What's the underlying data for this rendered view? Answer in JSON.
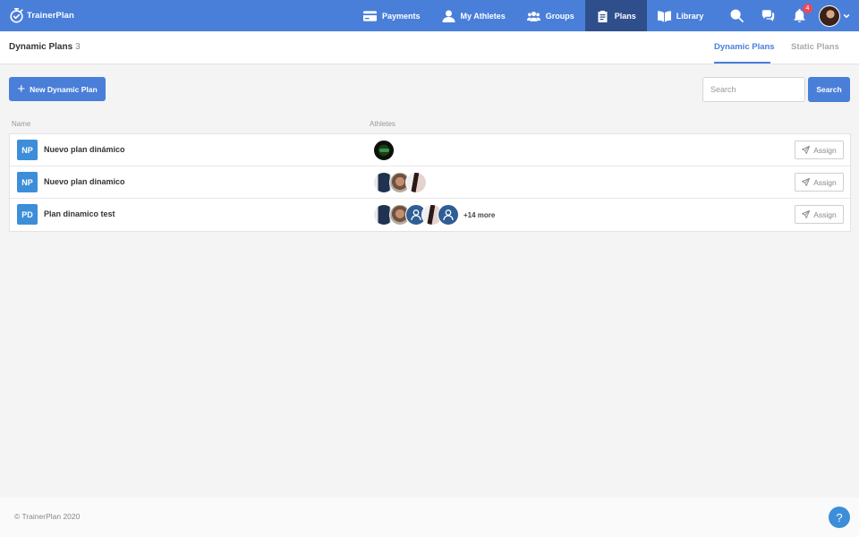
{
  "brand": {
    "name": "TrainerPlan",
    "icon": "stopwatch-check-icon"
  },
  "nav": {
    "items": [
      {
        "label": "Payments",
        "icon": "credit-card-icon",
        "active": false
      },
      {
        "label": "My Athletes",
        "icon": "user-icon",
        "active": false
      },
      {
        "label": "Groups",
        "icon": "users-icon",
        "active": false
      },
      {
        "label": "Plans",
        "icon": "clipboard-icon",
        "active": true
      },
      {
        "label": "Library",
        "icon": "book-icon",
        "active": false
      }
    ],
    "notifications_count": "4"
  },
  "subheader": {
    "title": "Dynamic Plans",
    "count": "3",
    "tabs": [
      {
        "label": "Dynamic Plans",
        "active": true
      },
      {
        "label": "Static Plans",
        "active": false
      }
    ]
  },
  "actions": {
    "new_label": "New Dynamic Plan",
    "search_placeholder": "Search",
    "search_value": "",
    "search_button": "Search"
  },
  "table": {
    "headers": {
      "name": "Name",
      "athletes": "Athletes"
    },
    "rows": [
      {
        "initials": "NP",
        "name": "Nuevo plan dinámico",
        "more": "",
        "assign": "Assign"
      },
      {
        "initials": "NP",
        "name": "Nuevo plan dinamico",
        "more": "",
        "assign": "Assign"
      },
      {
        "initials": "PD",
        "name": "Plan dinamico test",
        "more": "+14 more",
        "assign": "Assign"
      }
    ]
  },
  "footer": {
    "copyright": "© TrainerPlan 2020",
    "help": "?"
  },
  "colors": {
    "primary": "#4a7fd9",
    "nav_active": "#2f4f8c",
    "badge": "#e64a5c",
    "initials_bg": "#3d8ed8"
  }
}
